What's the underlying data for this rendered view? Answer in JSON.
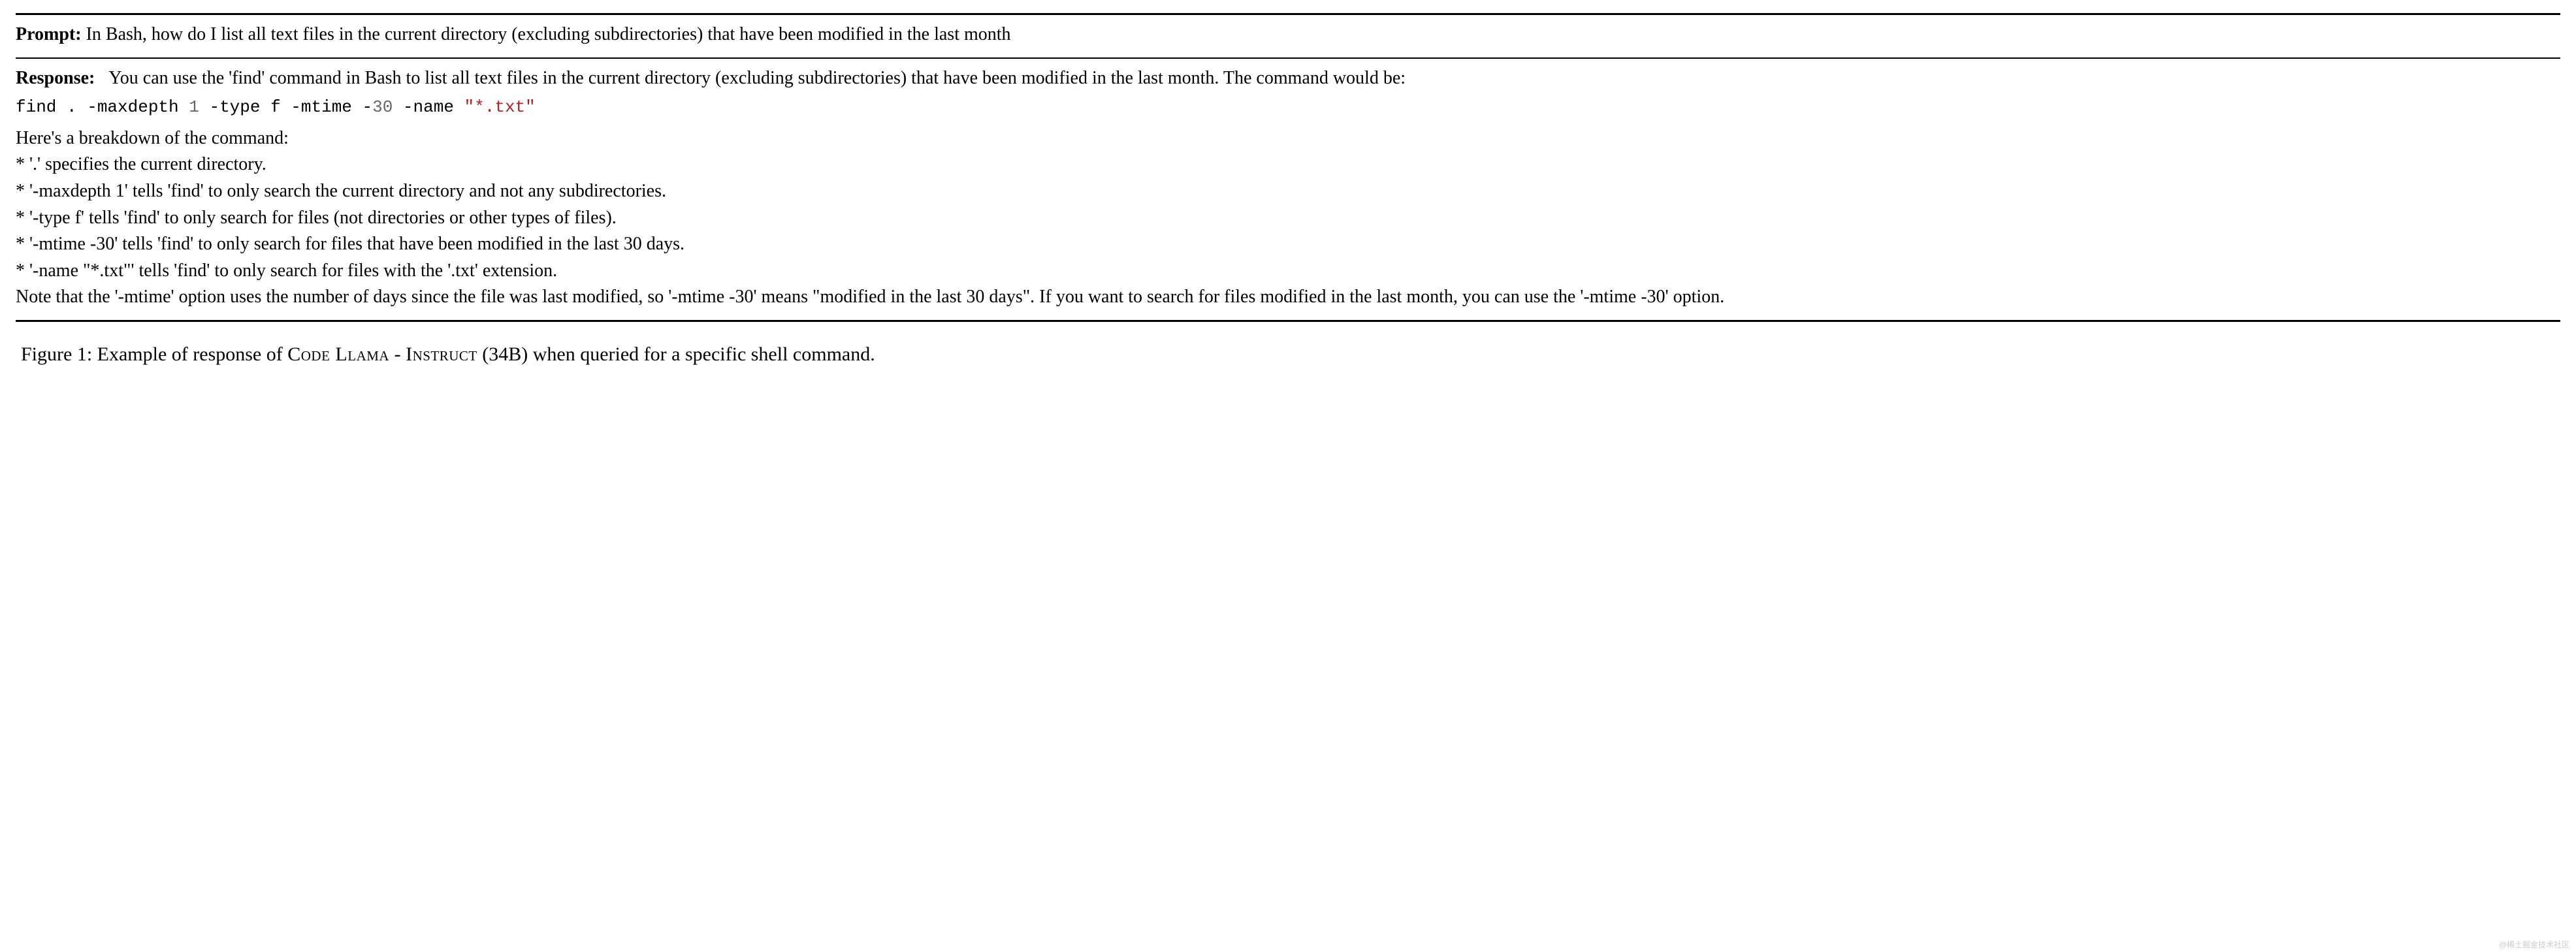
{
  "prompt": {
    "label": "Prompt:",
    "text": "In Bash, how do I list all text files in the current directory (excluding subdirectories) that have been modified in the last month"
  },
  "response": {
    "label": "Response:",
    "intro": "You can use the 'find' command in Bash to list all text files in the current directory (excluding subdirectories) that have been modified in the last month. The command would be:",
    "code": {
      "part1": "find . -maxdepth ",
      "num": "1",
      "part2": " -type f -mtime -",
      "num2": "30",
      "part3": " -name ",
      "str": "\"*.txt\""
    },
    "breakdown_intro": "Here's a breakdown of the command:",
    "bullets": [
      "* '.' specifies the current directory.",
      "* '-maxdepth 1' tells 'find' to only search the current directory and not any subdirectories.",
      "* '-type f' tells 'find' to only search for files (not directories or other types of files).",
      "* '-mtime -30' tells 'find' to only search for files that have been modified in the last 30 days.",
      "* '-name \"*.txt\"' tells 'find' to only search for files with the '.txt' extension."
    ],
    "note": "Note that the '-mtime' option uses the number of days since the file was last modified, so '-mtime -30' means \"modified in the last 30 days\". If you want to search for files modified in the last month, you can use the '-mtime -30' option."
  },
  "caption": {
    "prefix": "Figure 1: Example of response of ",
    "model_part1": "Code Llama",
    "separator": " - ",
    "model_part2": "Instruct",
    "suffix": " (34B) when queried for a specific shell command."
  },
  "watermark": "@稀土掘金技术社区"
}
